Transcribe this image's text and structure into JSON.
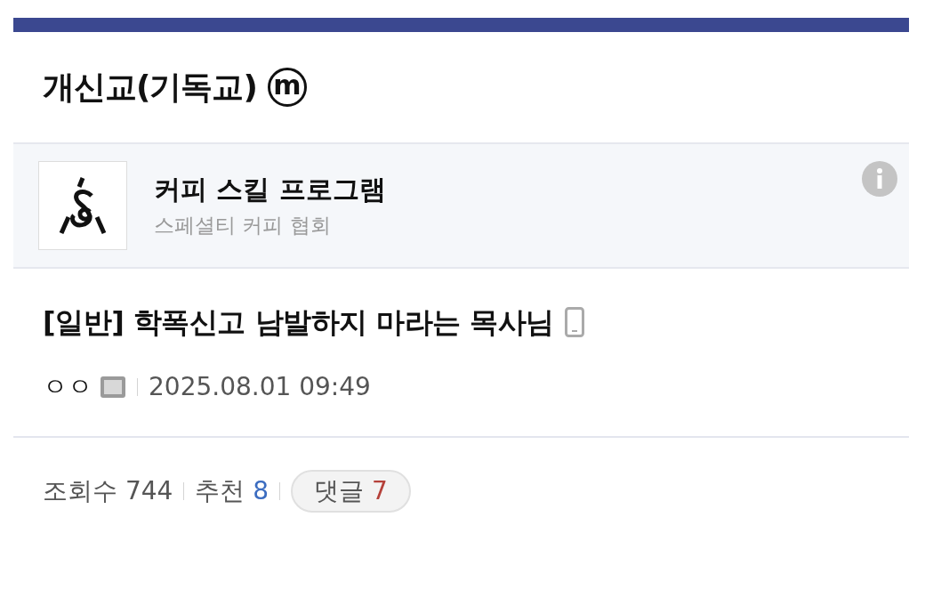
{
  "gallery": {
    "title": "개신교(기독교)",
    "badge": "m"
  },
  "ad": {
    "title": "커피 스킬 프로그램",
    "subtitle": "스페셜티 커피 협회"
  },
  "post": {
    "title": "[일반] 학폭신고 남발하지 마라는 목사님",
    "from_mobile": true,
    "author": "ㅇㅇ",
    "date": "2025.08.01 09:49"
  },
  "stats": {
    "views_label": "조회수",
    "views": "744",
    "recommend_label": "추천",
    "recommend": "8",
    "comments_label": "댓글",
    "comments": "7"
  }
}
